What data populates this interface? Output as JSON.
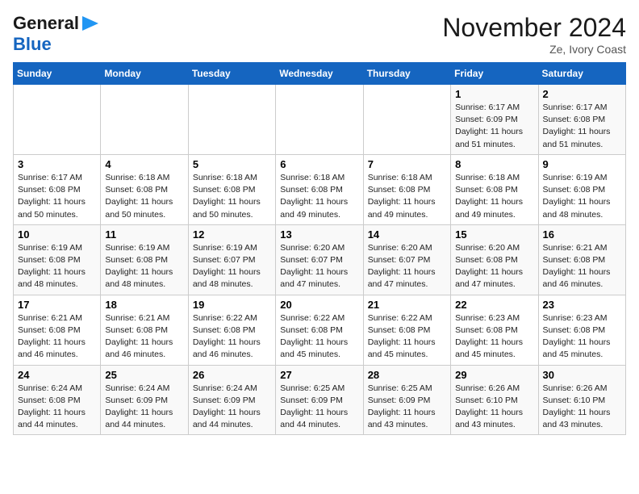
{
  "header": {
    "logo_general": "General",
    "logo_blue": "Blue",
    "month_title": "November 2024",
    "location": "Ze, Ivory Coast"
  },
  "weekdays": [
    "Sunday",
    "Monday",
    "Tuesday",
    "Wednesday",
    "Thursday",
    "Friday",
    "Saturday"
  ],
  "weeks": [
    [
      {
        "day": "",
        "info": ""
      },
      {
        "day": "",
        "info": ""
      },
      {
        "day": "",
        "info": ""
      },
      {
        "day": "",
        "info": ""
      },
      {
        "day": "",
        "info": ""
      },
      {
        "day": "1",
        "info": "Sunrise: 6:17 AM\nSunset: 6:09 PM\nDaylight: 11 hours and 51 minutes."
      },
      {
        "day": "2",
        "info": "Sunrise: 6:17 AM\nSunset: 6:08 PM\nDaylight: 11 hours and 51 minutes."
      }
    ],
    [
      {
        "day": "3",
        "info": "Sunrise: 6:17 AM\nSunset: 6:08 PM\nDaylight: 11 hours and 50 minutes."
      },
      {
        "day": "4",
        "info": "Sunrise: 6:18 AM\nSunset: 6:08 PM\nDaylight: 11 hours and 50 minutes."
      },
      {
        "day": "5",
        "info": "Sunrise: 6:18 AM\nSunset: 6:08 PM\nDaylight: 11 hours and 50 minutes."
      },
      {
        "day": "6",
        "info": "Sunrise: 6:18 AM\nSunset: 6:08 PM\nDaylight: 11 hours and 49 minutes."
      },
      {
        "day": "7",
        "info": "Sunrise: 6:18 AM\nSunset: 6:08 PM\nDaylight: 11 hours and 49 minutes."
      },
      {
        "day": "8",
        "info": "Sunrise: 6:18 AM\nSunset: 6:08 PM\nDaylight: 11 hours and 49 minutes."
      },
      {
        "day": "9",
        "info": "Sunrise: 6:19 AM\nSunset: 6:08 PM\nDaylight: 11 hours and 48 minutes."
      }
    ],
    [
      {
        "day": "10",
        "info": "Sunrise: 6:19 AM\nSunset: 6:08 PM\nDaylight: 11 hours and 48 minutes."
      },
      {
        "day": "11",
        "info": "Sunrise: 6:19 AM\nSunset: 6:08 PM\nDaylight: 11 hours and 48 minutes."
      },
      {
        "day": "12",
        "info": "Sunrise: 6:19 AM\nSunset: 6:07 PM\nDaylight: 11 hours and 48 minutes."
      },
      {
        "day": "13",
        "info": "Sunrise: 6:20 AM\nSunset: 6:07 PM\nDaylight: 11 hours and 47 minutes."
      },
      {
        "day": "14",
        "info": "Sunrise: 6:20 AM\nSunset: 6:07 PM\nDaylight: 11 hours and 47 minutes."
      },
      {
        "day": "15",
        "info": "Sunrise: 6:20 AM\nSunset: 6:08 PM\nDaylight: 11 hours and 47 minutes."
      },
      {
        "day": "16",
        "info": "Sunrise: 6:21 AM\nSunset: 6:08 PM\nDaylight: 11 hours and 46 minutes."
      }
    ],
    [
      {
        "day": "17",
        "info": "Sunrise: 6:21 AM\nSunset: 6:08 PM\nDaylight: 11 hours and 46 minutes."
      },
      {
        "day": "18",
        "info": "Sunrise: 6:21 AM\nSunset: 6:08 PM\nDaylight: 11 hours and 46 minutes."
      },
      {
        "day": "19",
        "info": "Sunrise: 6:22 AM\nSunset: 6:08 PM\nDaylight: 11 hours and 46 minutes."
      },
      {
        "day": "20",
        "info": "Sunrise: 6:22 AM\nSunset: 6:08 PM\nDaylight: 11 hours and 45 minutes."
      },
      {
        "day": "21",
        "info": "Sunrise: 6:22 AM\nSunset: 6:08 PM\nDaylight: 11 hours and 45 minutes."
      },
      {
        "day": "22",
        "info": "Sunrise: 6:23 AM\nSunset: 6:08 PM\nDaylight: 11 hours and 45 minutes."
      },
      {
        "day": "23",
        "info": "Sunrise: 6:23 AM\nSunset: 6:08 PM\nDaylight: 11 hours and 45 minutes."
      }
    ],
    [
      {
        "day": "24",
        "info": "Sunrise: 6:24 AM\nSunset: 6:08 PM\nDaylight: 11 hours and 44 minutes."
      },
      {
        "day": "25",
        "info": "Sunrise: 6:24 AM\nSunset: 6:09 PM\nDaylight: 11 hours and 44 minutes."
      },
      {
        "day": "26",
        "info": "Sunrise: 6:24 AM\nSunset: 6:09 PM\nDaylight: 11 hours and 44 minutes."
      },
      {
        "day": "27",
        "info": "Sunrise: 6:25 AM\nSunset: 6:09 PM\nDaylight: 11 hours and 44 minutes."
      },
      {
        "day": "28",
        "info": "Sunrise: 6:25 AM\nSunset: 6:09 PM\nDaylight: 11 hours and 43 minutes."
      },
      {
        "day": "29",
        "info": "Sunrise: 6:26 AM\nSunset: 6:10 PM\nDaylight: 11 hours and 43 minutes."
      },
      {
        "day": "30",
        "info": "Sunrise: 6:26 AM\nSunset: 6:10 PM\nDaylight: 11 hours and 43 minutes."
      }
    ]
  ]
}
